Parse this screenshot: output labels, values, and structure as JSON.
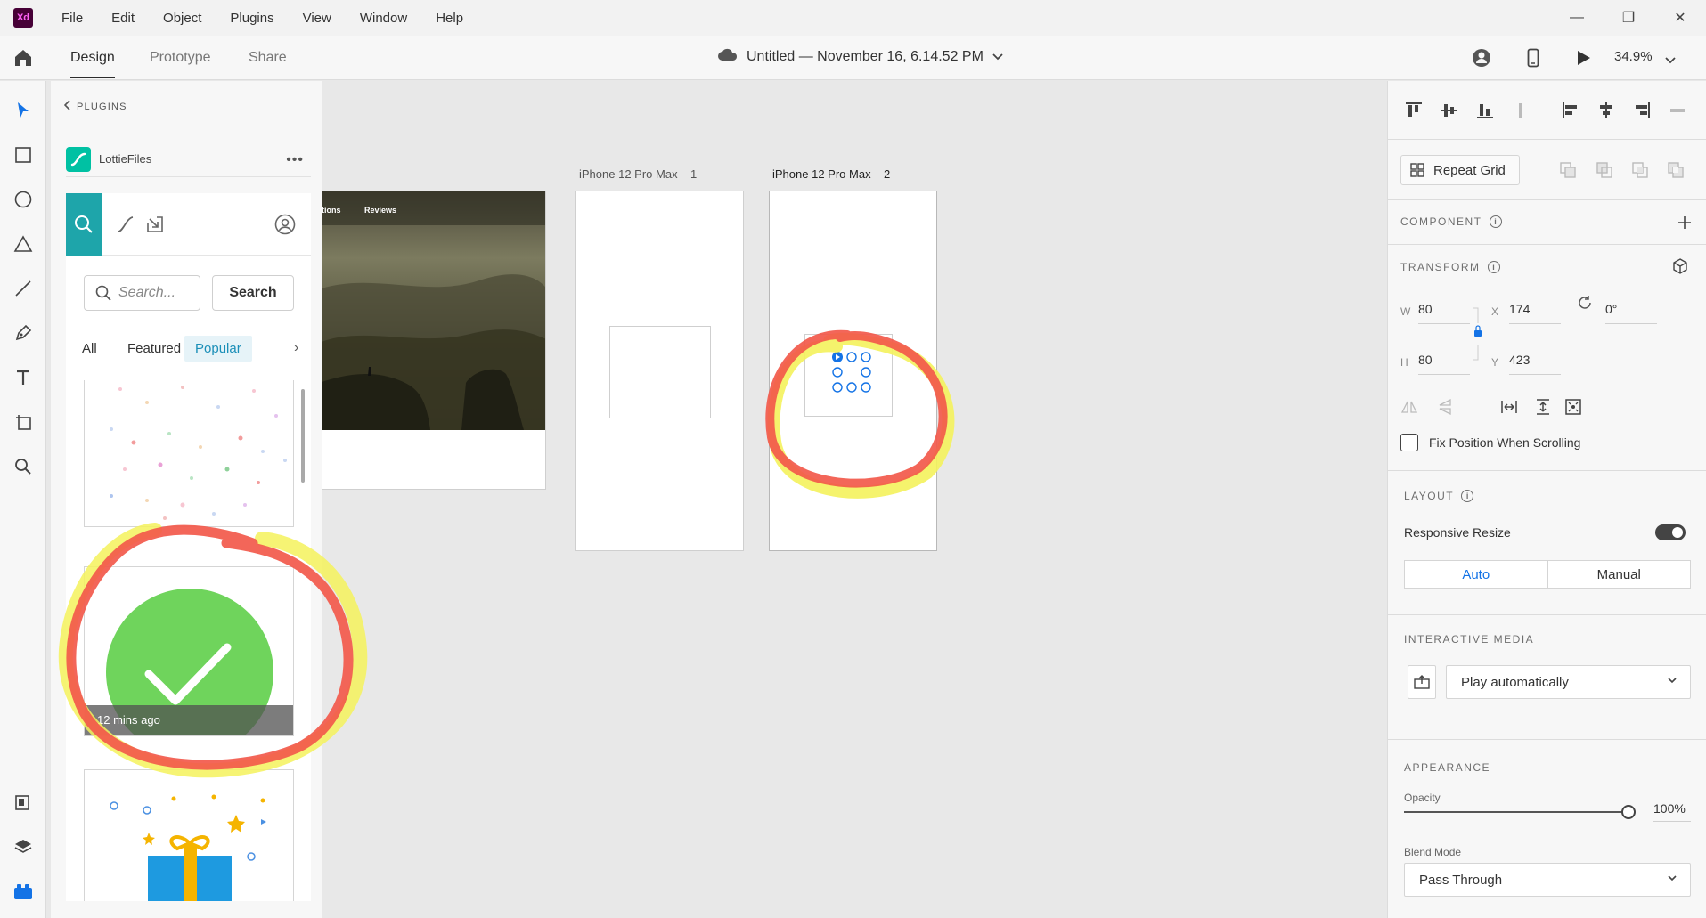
{
  "app": {
    "logo_text": "Xd"
  },
  "menu": {
    "items": [
      "File",
      "Edit",
      "Object",
      "Plugins",
      "View",
      "Window",
      "Help"
    ]
  },
  "window_controls": {
    "minimize": "—",
    "restore": "❐",
    "close": "✕"
  },
  "toolbar": {
    "modes": [
      "Design",
      "Prototype",
      "Share"
    ],
    "active_mode": "Design",
    "document_title": "Untitled — November 16, 6.14.52 PM",
    "zoom": "34.9%"
  },
  "left_tools": [
    "select-tool",
    "rectangle-tool",
    "ellipse-tool",
    "polygon-tool",
    "line-tool",
    "pen-tool",
    "text-tool",
    "artboard-tool",
    "zoom-tool"
  ],
  "left_bottom_tools": [
    "assets-panel",
    "layers-panel",
    "plugins-panel"
  ],
  "plugins_panel": {
    "breadcrumb": "PLUGINS",
    "plugin_name": "LottieFiles",
    "more_label": "•••",
    "search_placeholder": "Search...",
    "search_button": "Search",
    "filters": [
      "All",
      "Featured",
      "Popular"
    ],
    "active_filter": "Popular",
    "filter_more": "›",
    "card_caption": "12 mins ago"
  },
  "canvas": {
    "artboards": [
      {
        "label": "",
        "nav_items": [
          "tions",
          "Reviews"
        ]
      },
      {
        "label": "iPhone 12 Pro Max – 1"
      },
      {
        "label": "iPhone 12 Pro Max – 2"
      }
    ]
  },
  "properties": {
    "repeat_grid_label": "Repeat Grid",
    "component_title": "COMPONENT",
    "transform_title": "TRANSFORM",
    "w_label": "W",
    "w_value": "80",
    "h_label": "H",
    "h_value": "80",
    "x_label": "X",
    "x_value": "174",
    "y_label": "Y",
    "y_value": "423",
    "rotation_value": "0°",
    "fix_position_label": "Fix Position When Scrolling",
    "layout_title": "LAYOUT",
    "responsive_resize_label": "Responsive Resize",
    "responsive_resize_on": true,
    "layout_modes": [
      "Auto",
      "Manual"
    ],
    "active_layout_mode": "Auto",
    "interactive_media_title": "INTERACTIVE MEDIA",
    "play_option": "Play automatically",
    "appearance_title": "APPEARANCE",
    "opacity_label": "Opacity",
    "opacity_value": "100%",
    "opacity_level": 1.0,
    "blend_mode_label": "Blend Mode",
    "blend_mode_value": "Pass Through"
  },
  "colors": {
    "accent_blue": "#1473e6",
    "lottie_teal": "#1ea5aa",
    "annotation_red": "#f2594b",
    "annotation_yellow": "#f4f25c",
    "check_green": "#6fd45c"
  }
}
